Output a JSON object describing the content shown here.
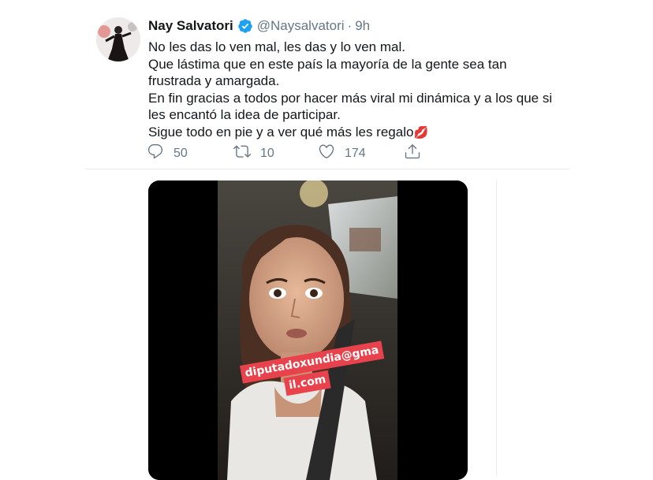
{
  "tweet": {
    "author_name": "Nay Salvatori",
    "verified": true,
    "handle": "@Naysalvatori",
    "separator": "·",
    "time": "9h",
    "text_lines": [
      "No les das lo ven mal, les das y lo ven mal.",
      "Que lástima que en este país la mayoría de la gente sea tan frustrada y amargada.",
      "En fin gracias a todos por hacer más viral mi dinámica y a los que si les encantó la idea de participar.",
      "Sigue todo en pie y a ver qué más les regalo"
    ],
    "emoji": "💋"
  },
  "actions": {
    "reply_count": "50",
    "retweet_count": "10",
    "like_count": "174"
  },
  "icons": {
    "reply": "reply-icon",
    "retweet": "retweet-icon",
    "like": "heart-icon",
    "share": "share-icon",
    "verified": "verified-badge-icon"
  },
  "media": {
    "sticker_line1": "diputadoxundia@gma",
    "sticker_line2": "il.com"
  },
  "colors": {
    "accent": "#1da1f2",
    "secondary_text": "#657786",
    "sticker_bg": "#e8424d"
  }
}
